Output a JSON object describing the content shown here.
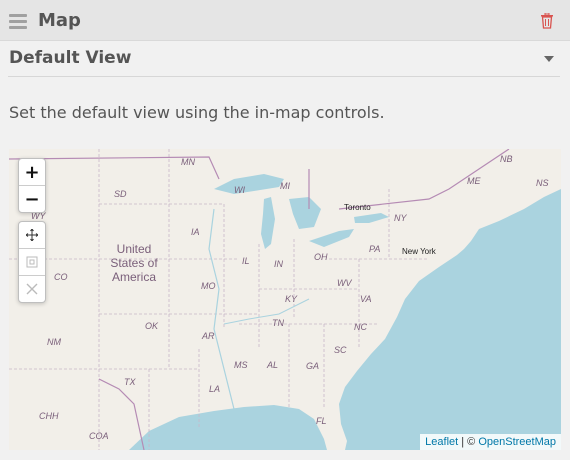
{
  "header": {
    "title": "Map",
    "menu_icon": "hamburger-icon",
    "delete_icon": "trash-icon",
    "delete_color": "#d9534f"
  },
  "section": {
    "title": "Default View",
    "toggle_icon": "caret-down-icon"
  },
  "description": "Set the default view using the in-map controls.",
  "map": {
    "controls": {
      "zoom_in": "+",
      "zoom_out": "−",
      "tools": [
        "move-icon",
        "fit-bounds-icon",
        "reset-icon"
      ]
    },
    "labels": {
      "states": [
        "MN",
        "WI",
        "MI",
        "SD",
        "WY",
        "IA",
        "IL",
        "IN",
        "OH",
        "PA",
        "NY",
        "ME",
        "NB",
        "NS",
        "CO",
        "MO",
        "KY",
        "WV",
        "VA",
        "NM",
        "OK",
        "AR",
        "TN",
        "NC",
        "SC",
        "MS",
        "AL",
        "GA",
        "TX",
        "LA",
        "FL",
        "CHH",
        "COA"
      ],
      "cities": [
        "Toronto",
        "New York"
      ],
      "country": [
        "United",
        "States of",
        "America"
      ]
    },
    "attribution": {
      "leaflet": "Leaflet",
      "separator": " | © ",
      "osm": "OpenStreetMap"
    }
  }
}
